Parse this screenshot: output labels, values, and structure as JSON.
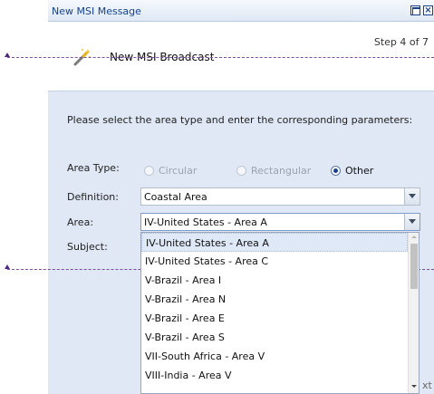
{
  "window": {
    "title": "New MSI Message"
  },
  "header": {
    "step": "Step 4 of 7",
    "title": "New MSI Broadcast"
  },
  "form": {
    "instruction": "Please select the area type and enter the corresponding parameters:",
    "area_type_label": "Area Type:",
    "area_type_options": [
      {
        "label": "Circular",
        "selected": false,
        "enabled": false
      },
      {
        "label": "Rectangular",
        "selected": false,
        "enabled": false
      },
      {
        "label": "Other",
        "selected": true,
        "enabled": true
      }
    ],
    "definition_label": "Definition:",
    "definition_value": "Coastal Area",
    "area_label": "Area:",
    "area_value": "IV-United States - Area A",
    "subject_label": "Subject:"
  },
  "area_dropdown": {
    "options": [
      "IV-United States - Area A",
      "IV-United States - Area C",
      "V-Brazil - Area I",
      "V-Brazil - Area N",
      "V-Brazil - Area E",
      "V-Brazil - Area S",
      "VII-South Africa - Area V",
      "VIII-India - Area V"
    ],
    "highlighted_index": 0
  },
  "footer": {
    "next_fragment": "xt"
  },
  "colors": {
    "title_text": "#15428b",
    "panel_bg": "#dfe8f4",
    "guide_line": "#7b4fa0"
  }
}
